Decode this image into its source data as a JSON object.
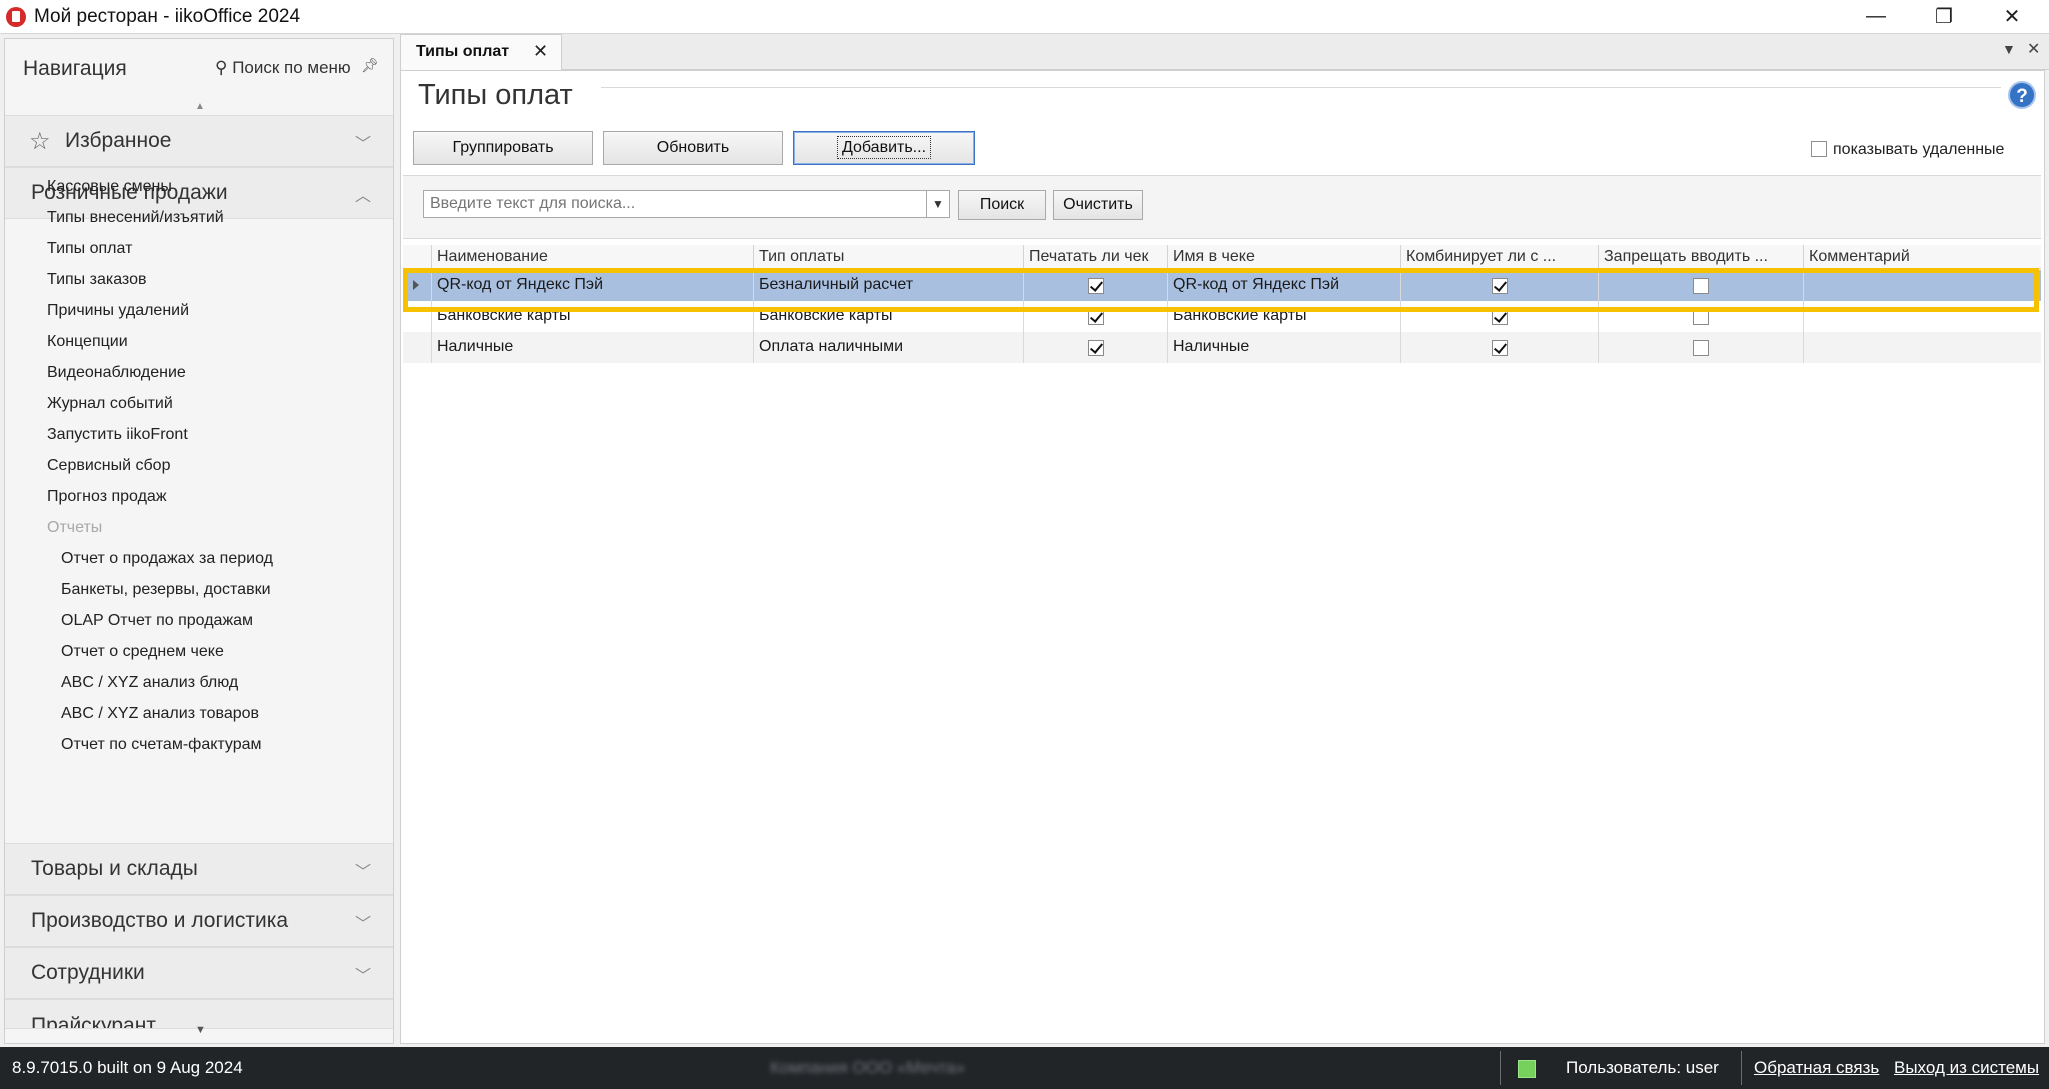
{
  "window": {
    "title": "Мой ресторан - iikoOffice 2024",
    "minimize_glyph": "—",
    "restore_glyph": "❐",
    "close_glyph": "✕"
  },
  "nav": {
    "title": "Навигация",
    "menu_search": "Поиск по меню",
    "groups": {
      "favorites": "Избранное",
      "retail": "Розничные продажи",
      "goods": "Товары и склады",
      "production": "Производство и логистика",
      "staff": "Сотрудники",
      "partial": "Прайскурант"
    },
    "items": [
      "Кассовые смены",
      "Типы внесений/изъятий",
      "Типы оплат",
      "Типы заказов",
      "Причины удалений",
      "Концепции",
      "Видеонаблюдение",
      "Журнал событий",
      "Запустить iikoFront",
      "Сервисный сбор",
      "Прогноз продаж"
    ],
    "reports_label": "Отчеты",
    "reports": [
      "Отчет о продажах за период",
      "Банкеты, резервы, доставки",
      "OLAP Отчет по продажам",
      "Отчет о среднем чеке",
      "ABC / XYZ анализ блюд",
      "ABC / XYZ анализ товаров",
      "Отчет по счетам-фактурам"
    ]
  },
  "tab": {
    "label": "Типы оплат",
    "close_glyph": "✕"
  },
  "page": {
    "title": "Типы оплат",
    "buttons": {
      "group": "Группировать",
      "refresh": "Обновить",
      "add": "Добавить..."
    },
    "show_deleted_label": "показывать удаленные",
    "help_glyph": "?"
  },
  "search": {
    "placeholder": "Введите текст для поиска...",
    "search_button": "Поиск",
    "clear_button": "Очистить"
  },
  "grid": {
    "columns": [
      "Наименование",
      "Тип оплаты",
      "Печатать ли чек",
      "Имя в чеке",
      "Комбинирует ли с ...",
      "Запрещать вводить ...",
      "Комментарий"
    ],
    "rows": [
      {
        "name": "QR-код от Яндекс Пэй",
        "type": "Безналичный расчет",
        "print_check": true,
        "check_name": "QR-код от Яндекс Пэй",
        "combines": true,
        "forbid": false,
        "comment": ""
      },
      {
        "name": "Банковские карты",
        "type": "Банковские карты",
        "print_check": true,
        "check_name": "Банковские карты",
        "combines": true,
        "forbid": false,
        "comment": ""
      },
      {
        "name": "Наличные",
        "type": "Оплата наличными",
        "print_check": true,
        "check_name": "Наличные",
        "combines": true,
        "forbid": false,
        "comment": ""
      }
    ],
    "selected_row": 0,
    "highlight_color": "#f6c100"
  },
  "status": {
    "version": "8.9.7015.0 built on 9 Aug 2024",
    "company": "Компания ООО «Мечта»",
    "user": "Пользователь: user",
    "feedback": "Обратная связь",
    "logout": "Выход из системы",
    "connection_color": "#76d15c"
  }
}
